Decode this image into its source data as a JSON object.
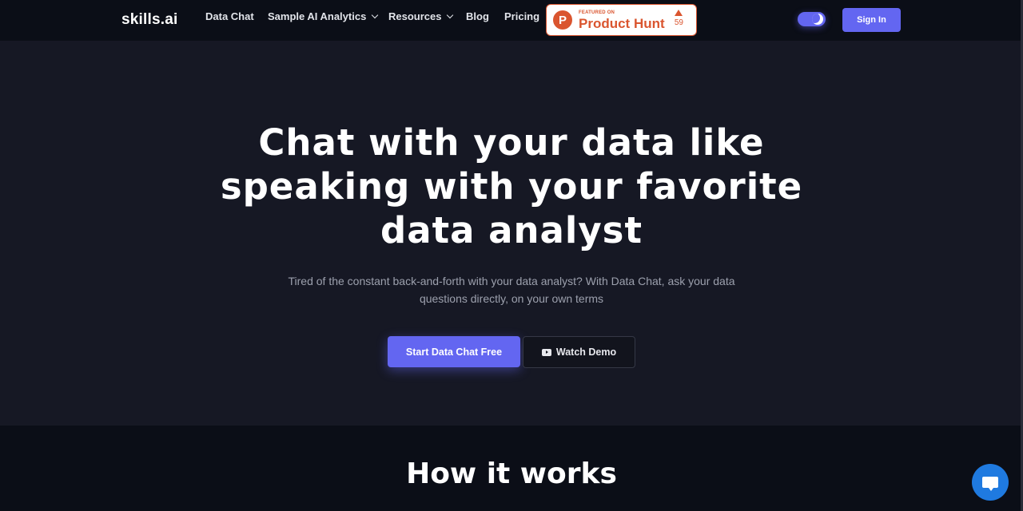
{
  "navbar": {
    "logo": "skills.ai",
    "items": [
      {
        "label": "Data Chat",
        "has_dropdown": false
      },
      {
        "label": "Sample AI Analytics",
        "has_dropdown": true
      },
      {
        "label": "Resources",
        "has_dropdown": true
      },
      {
        "label": "Blog",
        "has_dropdown": false
      },
      {
        "label": "Pricing",
        "has_dropdown": false
      }
    ],
    "product_hunt": {
      "featured_label": "FEATURED ON",
      "name": "Product Hunt",
      "logo_letter": "P",
      "votes": "59"
    },
    "theme_toggle": "dark-mode",
    "sign_in_label": "Sign In"
  },
  "hero": {
    "title_lines": [
      "Chat with your data like",
      "speaking with your favorite",
      "data analyst"
    ],
    "subtitle": "Tired of the constant back-and-forth with your data analyst? With Data Chat, ask your data questions directly, on your own terms",
    "primary_cta": "Start Data Chat Free",
    "secondary_cta": "Watch Demo"
  },
  "how_it_works": {
    "title": "How it works"
  },
  "colors": {
    "accent": "#6366f1",
    "product_hunt": "#da552f",
    "chat_widget": "#1f7ae0"
  }
}
